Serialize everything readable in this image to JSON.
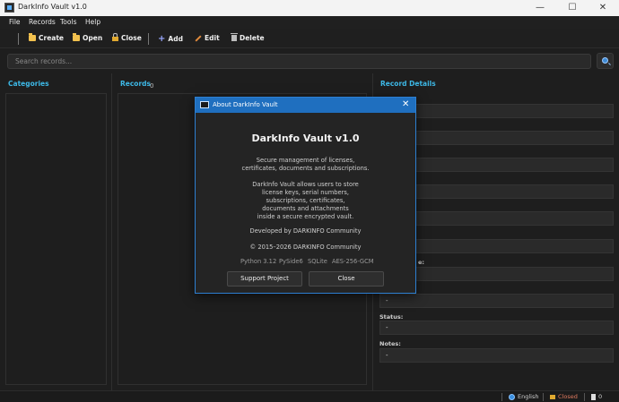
{
  "window": {
    "title": "DarkInfo Vault v1.0",
    "minimize": "—",
    "maximize": "☐",
    "close": "✕"
  },
  "menu": [
    "File",
    "Records",
    "Tools",
    "Help"
  ],
  "toolbar": {
    "create": "Create",
    "open": "Open",
    "close": "Close",
    "add": "Add",
    "edit": "Edit",
    "delete": "Delete"
  },
  "search": {
    "placeholder": "Search records..."
  },
  "panels": {
    "categories": "Categories",
    "records": "Records",
    "records_count": "0",
    "details": "Record Details"
  },
  "details": {
    "status_label": "Status:",
    "status_value": "-",
    "notes_label": "Notes:",
    "notes_value": "-",
    "partial_label": "e:",
    "field_value": "-"
  },
  "statusbar": {
    "language": "English",
    "vault": "Closed",
    "count": "0"
  },
  "about": {
    "title": "About DarkInfo Vault",
    "heading": "DarkInfo Vault v1.0",
    "desc1": "Secure management of licenses,",
    "desc2": "certificates, documents and subscriptions.",
    "para1": "DarkInfo Vault allows users to store",
    "para2": "license keys, serial numbers,",
    "para3": "subscriptions, certificates,",
    "para4": "documents and attachments",
    "para5": "inside a secure encrypted vault.",
    "developed": "Developed by DARKINFO Community",
    "copyright": "© 2015–2026 DARKINFO Community",
    "tech": [
      "Python 3.12",
      "PySide6",
      "SQLite",
      "AES-256-GCM"
    ],
    "support": "Support Project",
    "close": "Close"
  },
  "colors": {
    "accent": "#3db8e6",
    "dialog_title": "#1f6fbf",
    "vault_closed": "#e07a5f"
  }
}
